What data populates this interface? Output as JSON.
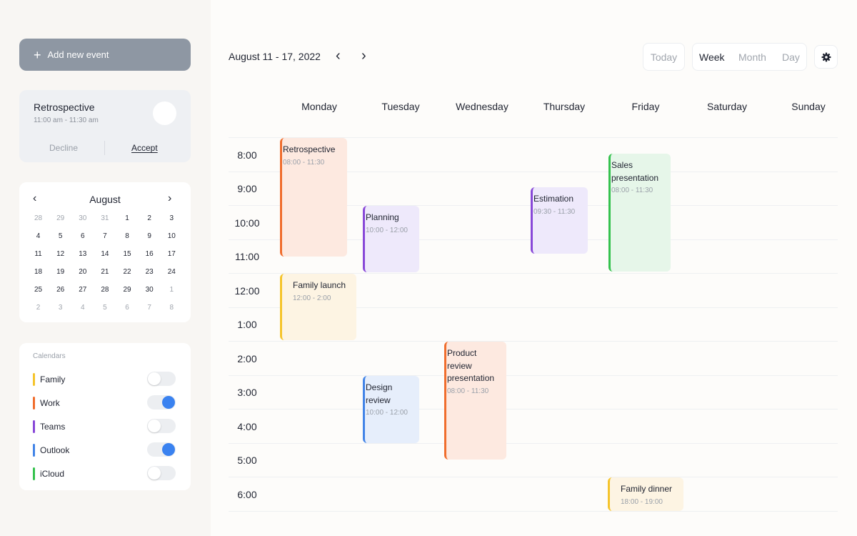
{
  "sidebar": {
    "add_event_label": "Add new event",
    "invite": {
      "title": "Retrospective",
      "time": "11:00 am - 11:30 am",
      "decline_label": "Decline",
      "accept_label": "Accept"
    },
    "mini_calendar": {
      "month": "August",
      "days": [
        "28",
        "29",
        "30",
        "31",
        "1",
        "2",
        "3",
        "4",
        "5",
        "6",
        "7",
        "8",
        "9",
        "10",
        "11",
        "12",
        "13",
        "14",
        "15",
        "16",
        "17",
        "18",
        "19",
        "20",
        "21",
        "22",
        "23",
        "24",
        "25",
        "26",
        "27",
        "28",
        "29",
        "30",
        "1",
        "2",
        "3",
        "4",
        "5",
        "6",
        "7",
        "8"
      ]
    },
    "calendars": {
      "heading": "Calendars",
      "items": [
        {
          "label": "Family",
          "color": "#f5c42c",
          "enabled": false
        },
        {
          "label": "Work",
          "color": "#f06d2d",
          "enabled": true
        },
        {
          "label": "Teams",
          "color": "#8848d8",
          "enabled": false
        },
        {
          "label": "Outlook",
          "color": "#4284e7",
          "enabled": true
        },
        {
          "label": "iCloud",
          "color": "#35c24e",
          "enabled": false
        }
      ]
    }
  },
  "toolbar": {
    "date_range": "August 11 - 17, 2022",
    "today_label": "Today",
    "views": {
      "week": "Week",
      "month": "Month",
      "day": "Day"
    },
    "active_view": "Week"
  },
  "week": {
    "days": [
      "Monday",
      "Tuesday",
      "Wednesday",
      "Thursday",
      "Friday",
      "Saturday",
      "Sunday"
    ],
    "hours": [
      "8:00",
      "9:00",
      "10:00",
      "11:00",
      "12:00",
      "1:00",
      "2:00",
      "3:00",
      "4:00",
      "5:00",
      "6:00"
    ]
  },
  "events": [
    {
      "title": "Retrospective",
      "time": "08:00 - 11:30",
      "color": "orange"
    },
    {
      "title": "Family launch",
      "time": "12:00 - 2:00",
      "color": "yellow"
    },
    {
      "title": "Planning",
      "time": "10:00 - 12:00",
      "color": "purple"
    },
    {
      "title": "Design review",
      "time": "10:00 - 12:00",
      "color": "blue"
    },
    {
      "title": "Product review presentation",
      "time": "08:00 - 11:30",
      "color": "orange"
    },
    {
      "title": "Estimation",
      "time": "09:30 - 11:30",
      "color": "purple"
    },
    {
      "title": "Sales presentation",
      "time": "08:00 - 11:30",
      "color": "green"
    },
    {
      "title": "Family dinner",
      "time": "18:00 - 19:00",
      "color": "yellow"
    }
  ]
}
